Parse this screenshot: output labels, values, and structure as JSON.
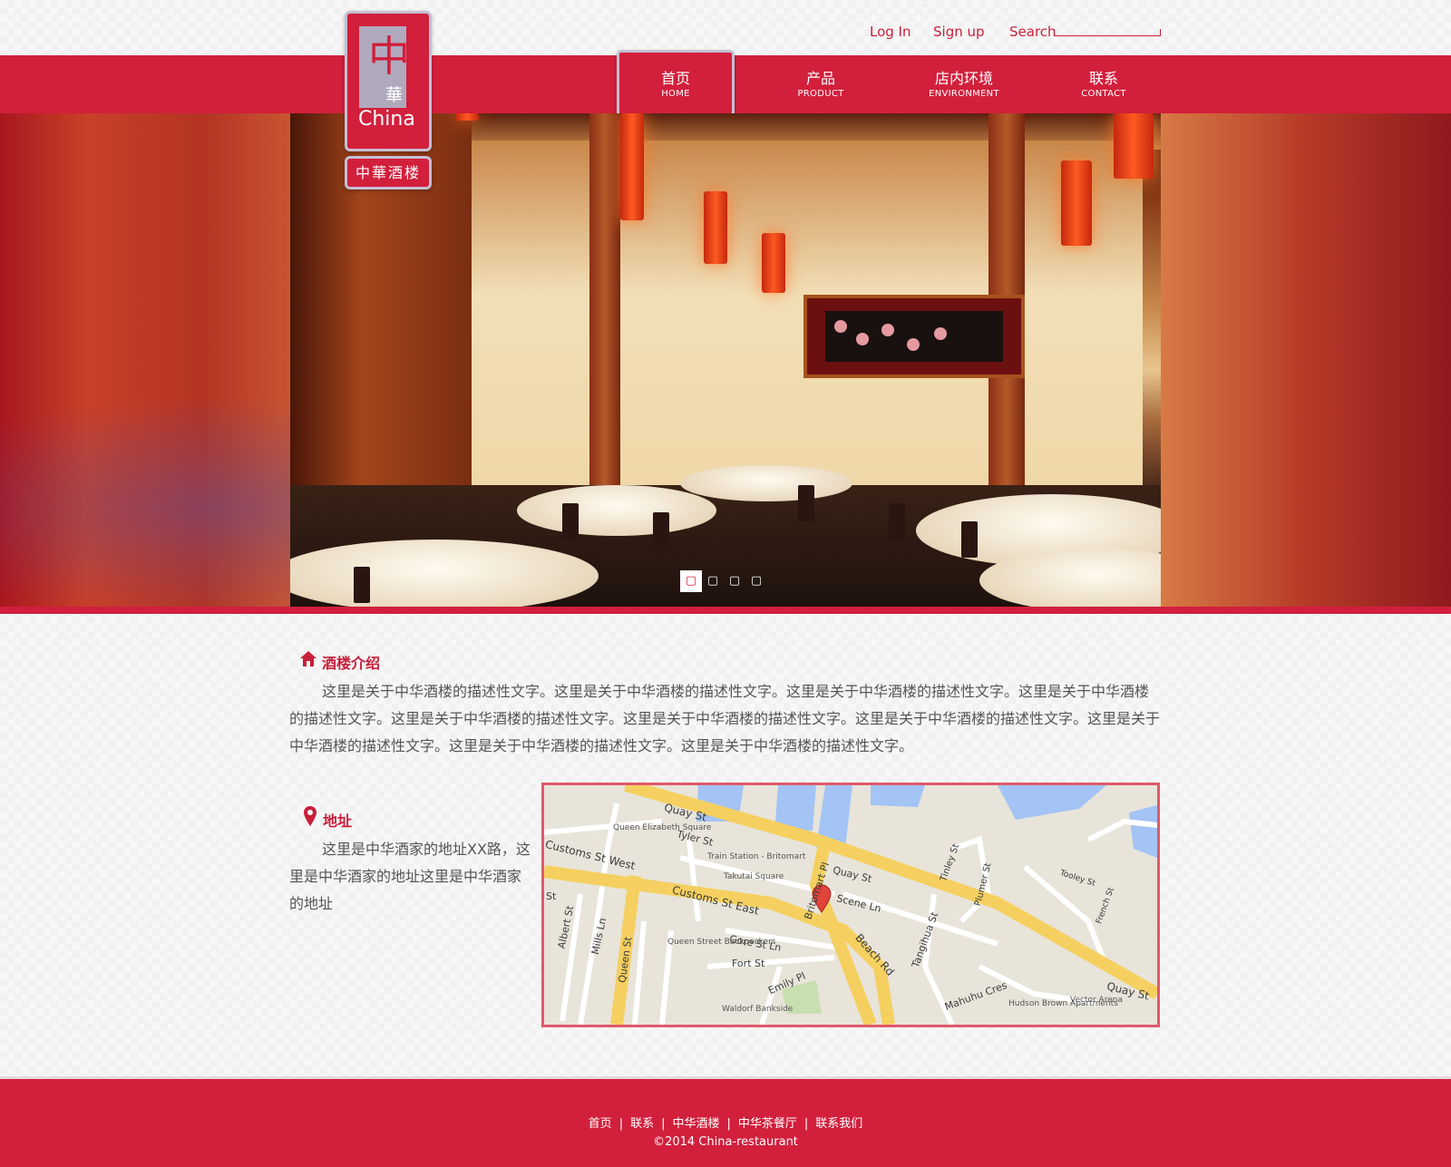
{
  "header": {
    "login_label": "Log In",
    "signup_label": "Sign up",
    "search_label": "Search",
    "search_value": ""
  },
  "logo": {
    "glyph": "中",
    "sub_glyph": "華",
    "text": "China",
    "badge": "中華酒楼"
  },
  "nav": [
    {
      "cn": "首页",
      "en": "HOME",
      "active": true
    },
    {
      "cn": "产品",
      "en": "PRODUCT",
      "active": false
    },
    {
      "cn": "店内环境",
      "en": "ENVIRONMENT",
      "active": false
    },
    {
      "cn": "联系",
      "en": "CONTACT",
      "active": false
    }
  ],
  "slider": {
    "dot_icon": "▢",
    "dots": 4,
    "active_index": 0
  },
  "intro": {
    "title": "酒楼介绍",
    "icon": "home-icon",
    "text": "这里是关于中华酒楼的描述性文字。这里是关于中华酒楼的描述性文字。这里是关于中华酒楼的描述性文字。这里是关于中华酒楼的描述性文字。这里是关于中华酒楼的描述性文字。这里是关于中华酒楼的描述性文字。这里是关于中华酒楼的描述性文字。这里是关于中华酒楼的描述性文字。这里是关于中华酒楼的描述性文字。这里是关于中华酒楼的描述性文字。"
  },
  "address": {
    "title": "地址",
    "icon": "location-pin-icon",
    "text": "这里是中华酒家的地址XX路，这里是中华酒家的地址这里是中华酒家的地址"
  },
  "map": {
    "streets": [
      "Quay St",
      "Customs St West",
      "Customs St East",
      "Tyler St",
      "Britomart Pl",
      "Gore St Ln",
      "Fort St",
      "Beach Rd",
      "Albert St",
      "Mills Ln",
      "Queen St",
      "Emily Pl",
      "Tangihua St",
      "Tinley St",
      "Plumer St",
      "Tooley St",
      "French St",
      "Mahuhu Cres",
      "Quay St",
      "St",
      "Gore St",
      "Queen St",
      "Scene Ln"
    ],
    "places": [
      "Queen Elizabeth Square",
      "Train Station - Britomart",
      "Takutai Square",
      "Queen Street Backpackers",
      "Waldorf Bankside",
      "Hudson Brown Apartments",
      "Vector Arena"
    ],
    "colors": {
      "road": "#f5d060",
      "water": "#a3c4f5",
      "land": "#e8e4da",
      "park": "#c8dfb0"
    }
  },
  "footer": {
    "links": [
      "首页",
      "联系",
      "中华酒楼",
      "中华茶餐厅",
      "联系我们"
    ],
    "separator": "|",
    "copyright": "©2014 China-restaurant"
  },
  "colors": {
    "brand_red": "#d21f3c",
    "text_gray": "#555555",
    "border_lilac": "#c5bfd4"
  }
}
